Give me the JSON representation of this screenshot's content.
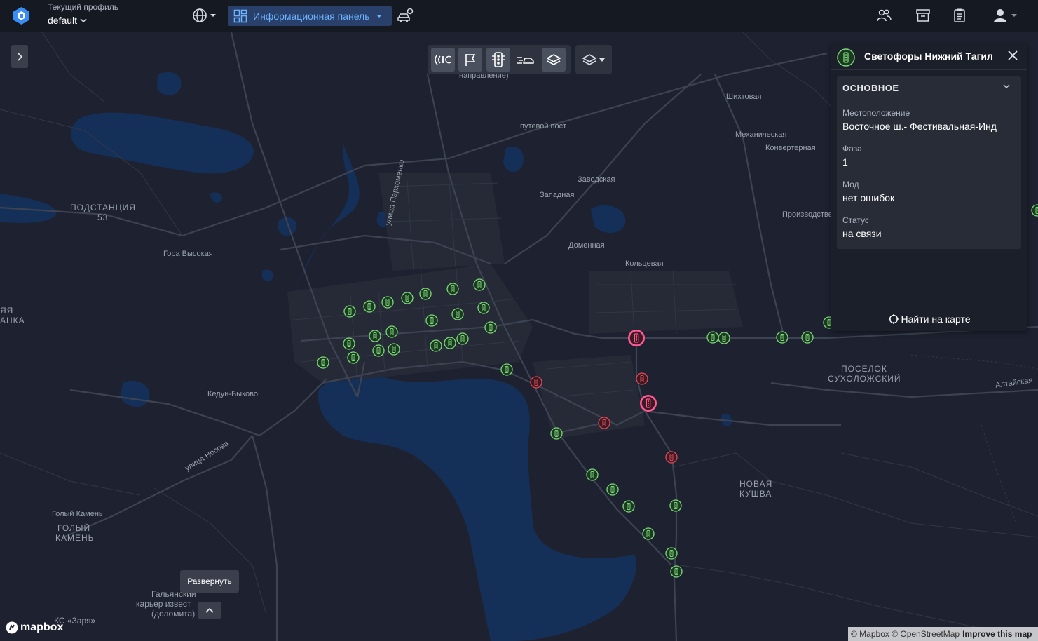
{
  "header": {
    "profile_caption": "Текущий профиль",
    "profile_value": "default",
    "dashboard_label": "Информационная панель"
  },
  "map": {
    "labels": {
      "napravlenie": "направление)",
      "shikhtovaya": "Шихтовая",
      "putevoy_post": "путевой пост",
      "mekhanicheskaya": "Механическая",
      "konverternaya": "Конвертерная",
      "zavodskaya": "Заводская",
      "zapadnaya": "Западная",
      "proizvodstvennaya": "Производственная",
      "domennaya": "Доменная",
      "koltsevaya": "Кольцевая",
      "podstantsiya": "ПОДСТАНЦИЯ",
      "podstantsiya_num": "53",
      "gora_vysokaya": "Гора Высокая",
      "yaya": "ЯЯ",
      "anka": "АНКА",
      "ulitsa_parkhomenko": "улица Пархоменко",
      "kedun_bykovo": "Кедун-Быково",
      "ulitsa_nosova": "улица Носова",
      "golyy_kamen_small": "Голый Камень",
      "golyy": "ГОЛЫЙ",
      "kamen": "КАМЕНЬ",
      "galyanskiy_1": "Гальянский",
      "galyanskiy_2": "карьер извест",
      "galyanskiy_3": "(доломита)",
      "ks_zarya": "КС «Заря»",
      "poselok": "ПОСЕЛОК",
      "sukholozhskiy": "СУХОЛОЖСКИЙ",
      "altayskaya": "Алтайская",
      "novaya": "НОВАЯ",
      "kushva": "КУШВА"
    },
    "traffic_light_statuses": [
      "ok",
      "ok",
      "ok",
      "ok",
      "ok",
      "ok",
      "ok",
      "ok",
      "ok",
      "ok",
      "ok",
      "ok",
      "ok",
      "ok",
      "ok",
      "ok",
      "ok",
      "ok",
      "ok",
      "ok",
      "ok",
      "ok",
      "ok",
      "ok",
      "error",
      "selected",
      "ok",
      "ok",
      "ok",
      "ok",
      "ok",
      "ok",
      "ok",
      "error",
      "ok",
      "ok",
      "ok",
      "ok",
      "ok",
      "ok",
      "ok",
      "ok",
      "ok",
      "ok"
    ],
    "status_colors": {
      "ok": "#7ed87a",
      "error": "#e04a5a",
      "selected": "#ff5a96"
    }
  },
  "panel": {
    "title": "Светофоры Нижний Тагил",
    "section_title": "ОСНОВНОЕ",
    "fields": [
      {
        "label": "Местоположение",
        "value": "Восточное ш.- Фестивальная-Инд"
      },
      {
        "label": "Фаза",
        "value": "1"
      },
      {
        "label": "Мод",
        "value": "нет ошибок"
      },
      {
        "label": "Статус",
        "value": "на связи"
      }
    ],
    "find_on_map": "Найти на карте"
  },
  "tooltip": "Развернуть",
  "mapbox_logo": "mapbox",
  "attribution": {
    "text": "© Mapbox © OpenStreetMap",
    "improve": "Improve this map"
  }
}
